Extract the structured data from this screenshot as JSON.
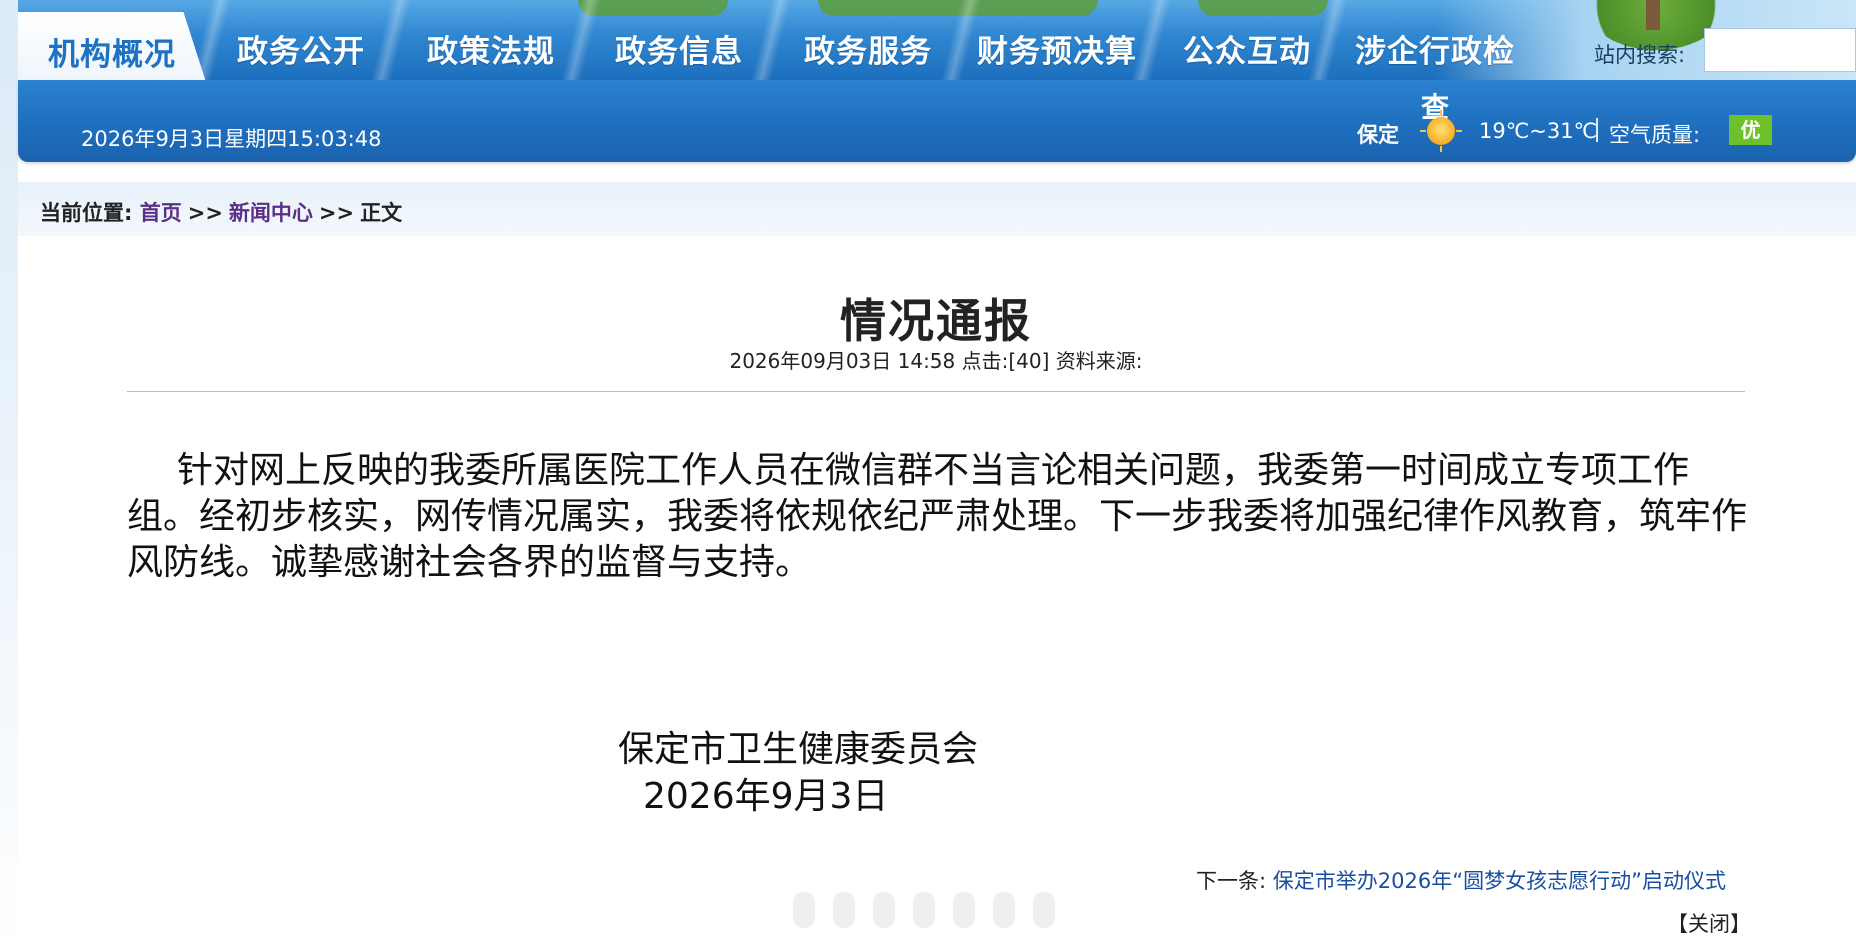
{
  "nav": {
    "items": [
      "机构概况",
      "政务公开",
      "政策法规",
      "政务信息",
      "政务服务",
      "财务预决算",
      "公众互动",
      "涉企行政检"
    ],
    "active_index": 0
  },
  "search": {
    "label": "站内搜索:",
    "value": "",
    "placeholder": ""
  },
  "info_bar": {
    "datetime": "2026年9月3日星期四15:03:48",
    "weather": {
      "city": "保定",
      "link": "查",
      "icon": "sun-icon",
      "temp": "19℃~31℃",
      "air_quality_label": "空气质量:",
      "air_quality_value": "优",
      "air_quality_color": "#6fc12b"
    }
  },
  "breadcrumb": {
    "label": "当前位置:",
    "home": "首页",
    "sep": ">>",
    "section": "新闻中心",
    "current": "正文"
  },
  "article": {
    "title": "情况通报",
    "meta": "2026年09月03日 14:58  点击:[40] 资料来源:",
    "body": "针对网上反映的我委所属医院工作人员在微信群不当言论相关问题，我委第一时间成立专项工作组。经初步核实，网传情况属实，我委将依规依纪严肃处理。下一步我委将加强纪律作风教育，筑牢作风防线。诚挚感谢社会各界的监督与支持。",
    "sign_org": "保定市卫生健康委员会",
    "sign_date": "2026年9月3日"
  },
  "footer": {
    "next_label": "下一条:",
    "next_title": "保定市举办2026年“圆梦女孩志愿行动”启动仪式",
    "close": "【关闭】"
  },
  "colors": {
    "nav_blue": "#2f86d0",
    "active_tab_text": "#1e72c2",
    "link_purple": "#5b2f86",
    "link_blue": "#1a4fa0"
  }
}
